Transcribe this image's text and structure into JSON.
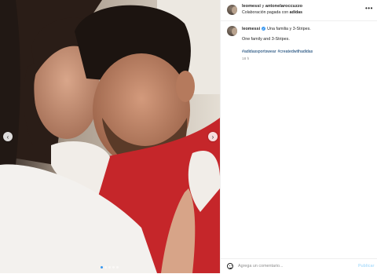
{
  "header": {
    "author_1": "leomessi",
    "joiner": " y ",
    "author_2": "antonelaroccuzzo",
    "collab_prefix": "Colaboración pagada con ",
    "collab_brand": "adidas",
    "more_icon": "more-horizontal-icon"
  },
  "caption": {
    "username": "leomessi",
    "verified_icon": "verified-badge-icon",
    "line_1": "Una familia y 3-Stripes.",
    "line_2": "One family and 3-Stripes.",
    "hashtags": [
      "#adidassportswear",
      "#createdwithadidas"
    ],
    "time": "18 h"
  },
  "carousel": {
    "prev_icon": "chevron-left-icon",
    "next_icon": "chevron-right-icon",
    "dot_count": 5,
    "active_index": 0
  },
  "footer": {
    "placeholder": "Agrega un comentario...",
    "publish_label": "Publicar",
    "emoji_icon": "emoji-icon"
  },
  "colors": {
    "accent": "#3897f0",
    "link": "#00376b",
    "muted": "#8e8e8e",
    "publish_disabled": "#b2dffc"
  }
}
